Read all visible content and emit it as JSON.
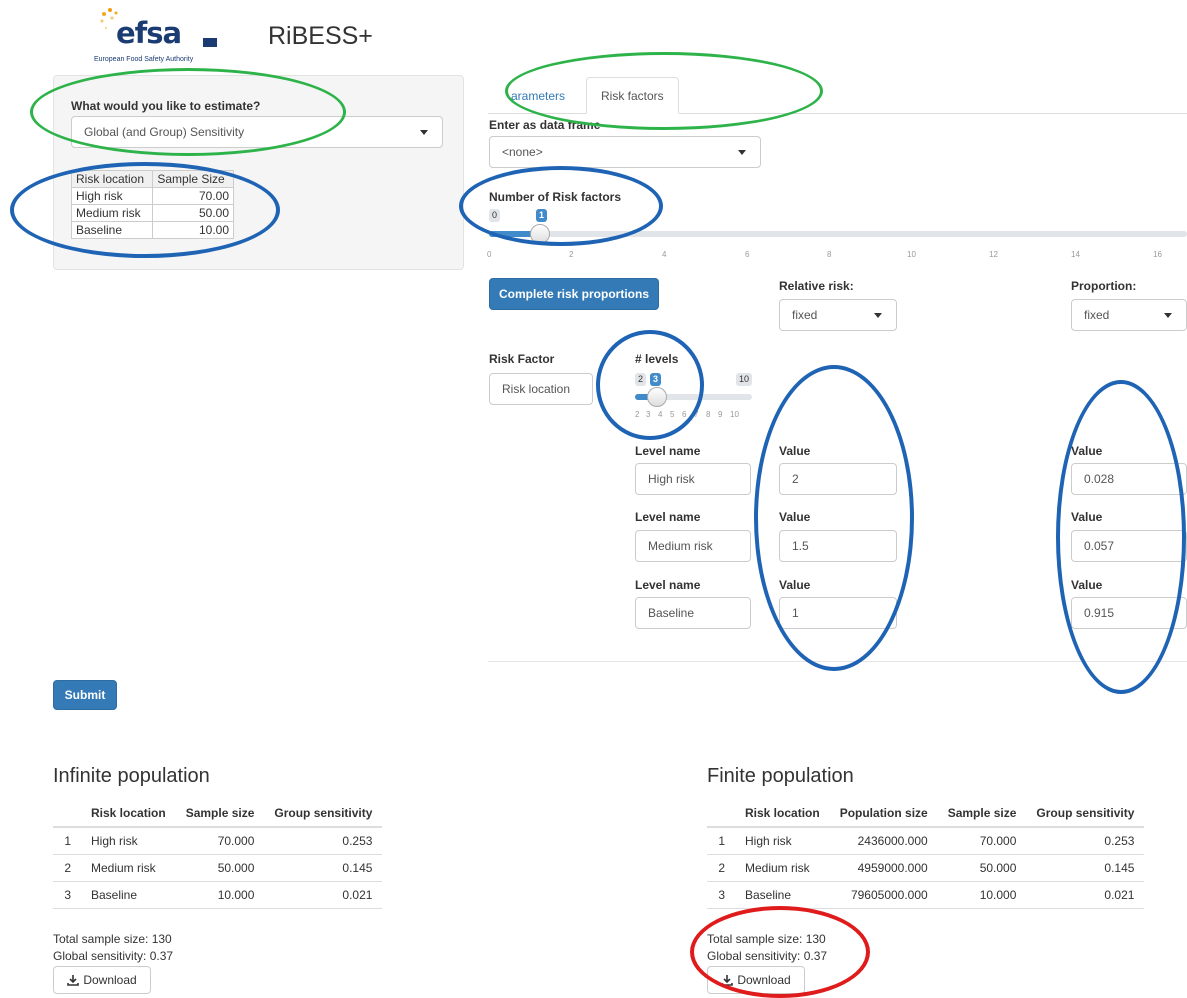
{
  "header": {
    "logo_word": "efsa",
    "logo_subtitle": "European Food Safety Authority",
    "app_title": "RiBESS+"
  },
  "sidebar": {
    "question_label": "What would you like to estimate?",
    "estimate_select_value": "Global (and Group) Sensitivity",
    "sample_table": {
      "headers": [
        "Risk location",
        "Sample Size"
      ],
      "rows": [
        [
          "High risk",
          "70.00"
        ],
        [
          "Medium risk",
          "50.00"
        ],
        [
          "Baseline",
          "10.00"
        ]
      ]
    }
  },
  "tabs": [
    {
      "label": "arameters",
      "active": false
    },
    {
      "label": "Risk factors",
      "active": true
    }
  ],
  "risk_factors": {
    "data_frame_label": "Enter as data frame",
    "data_frame_value": "<none>",
    "num_factors_label": "Number of Risk factors",
    "num_factors_min": "0",
    "num_factors_value": "1",
    "num_factors_ticks": [
      "0",
      "2",
      "4",
      "6",
      "8",
      "10",
      "12",
      "14",
      "16"
    ],
    "complete_button": "Complete risk proportions",
    "relative_risk_label": "Relative risk:",
    "relative_risk_value": "fixed",
    "proportion_label": "Proportion:",
    "proportion_value": "fixed",
    "risk_factor_label": "Risk Factor",
    "risk_factor_value": "Risk location",
    "levels_label": "# levels",
    "levels_min": "2",
    "levels_value": "3",
    "levels_max": "10",
    "levels_ticks": [
      "2",
      "3",
      "4",
      "5",
      "6",
      "7",
      "8",
      "9",
      "10"
    ],
    "levels": [
      {
        "name_label": "Level name",
        "name": "High risk",
        "rr_label": "Value",
        "rr": "2",
        "prop_label": "Value",
        "prop": "0.028"
      },
      {
        "name_label": "Level name",
        "name": "Medium risk",
        "rr_label": "Value",
        "rr": "1.5",
        "prop_label": "Value",
        "prop": "0.057"
      },
      {
        "name_label": "Level name",
        "name": "Baseline",
        "rr_label": "Value",
        "rr": "1",
        "prop_label": "Value",
        "prop": "0.915"
      }
    ]
  },
  "submit_label": "Submit",
  "infinite": {
    "title": "Infinite population",
    "headers": [
      "",
      "Risk location",
      "Sample size",
      "Group sensitivity"
    ],
    "rows": [
      [
        "1",
        "High risk",
        "70.000",
        "0.253"
      ],
      [
        "2",
        "Medium risk",
        "50.000",
        "0.145"
      ],
      [
        "3",
        "Baseline",
        "10.000",
        "0.021"
      ]
    ],
    "total": "Total sample size: 130",
    "global": "Global sensitivity: 0.37",
    "download": "Download"
  },
  "finite": {
    "title": "Finite population",
    "headers": [
      "",
      "Risk location",
      "Population size",
      "Sample size",
      "Group sensitivity"
    ],
    "rows": [
      [
        "1",
        "High risk",
        "2436000.000",
        "70.000",
        "0.253"
      ],
      [
        "2",
        "Medium risk",
        "4959000.000",
        "50.000",
        "0.145"
      ],
      [
        "3",
        "Baseline",
        "79605000.000",
        "10.000",
        "0.021"
      ]
    ],
    "total": "Total sample size: 130",
    "global": "Global sensitivity: 0.37",
    "download": "Download"
  },
  "icons": {
    "download": "download-icon",
    "caret": "caret-down-icon"
  },
  "colors": {
    "primary": "#337ab7",
    "slider_fill": "#428bca",
    "annotation_green": "#2db34a",
    "annotation_blue": "#1e63b4",
    "annotation_red": "#e01b1b"
  }
}
